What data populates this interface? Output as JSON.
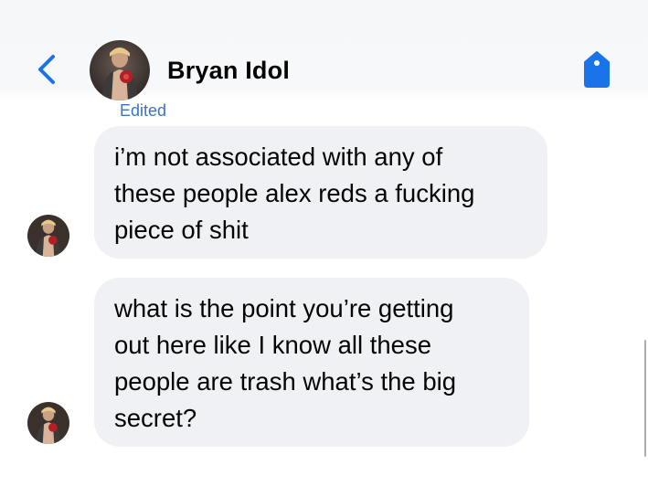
{
  "header": {
    "contact_name": "Bryan Idol",
    "back_icon": "chevron-left-icon",
    "action_icon": "tag-icon",
    "accent_color": "#1a73e8"
  },
  "messages": {
    "edited_label": "Edited",
    "bubble_color": "#f0f1f4",
    "items": [
      {
        "lines": [
          "i’m not associated with any of",
          "these people alex reds  a fucking",
          "piece of shit"
        ]
      },
      {
        "lines": [
          "what is the point you’re getting",
          "out here like I know all these",
          "people are trash what’s the big",
          "secret?"
        ]
      }
    ]
  }
}
